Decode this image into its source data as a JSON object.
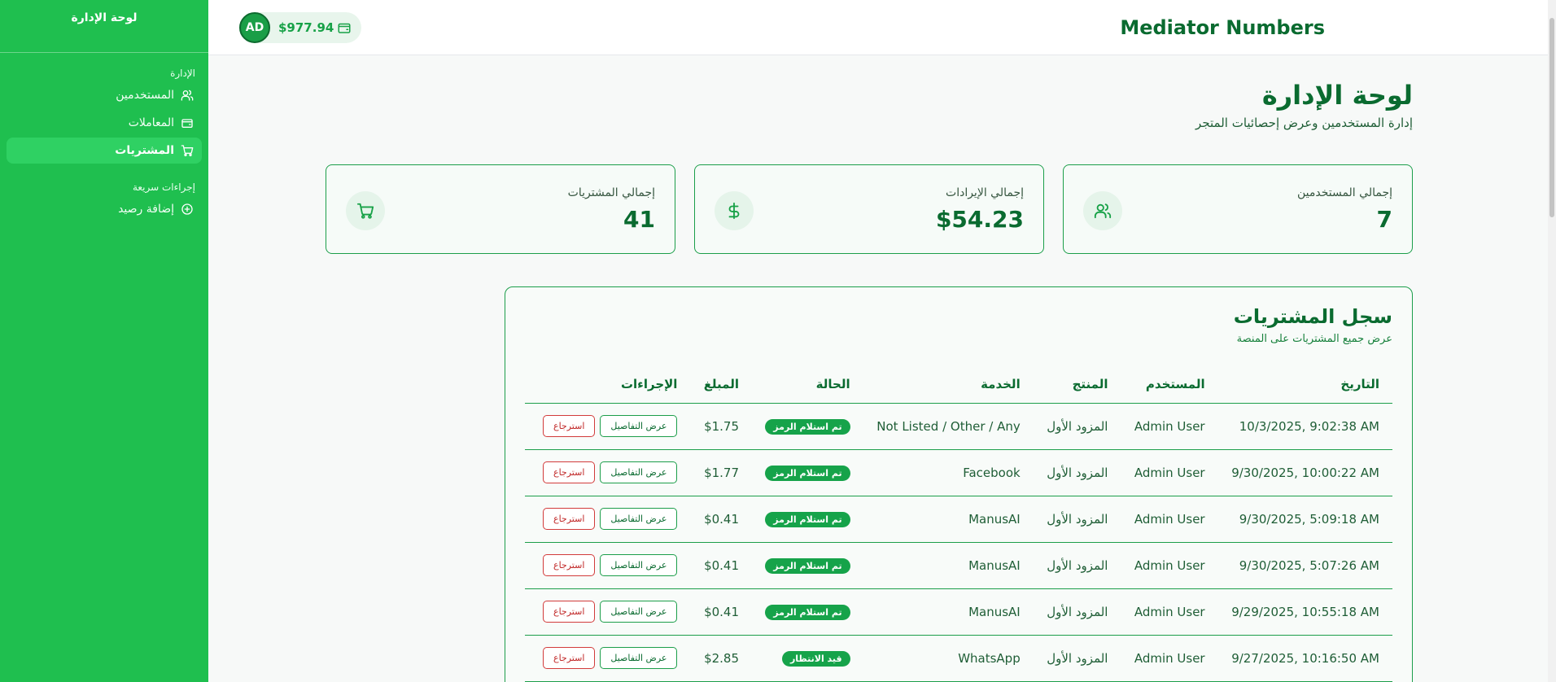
{
  "sidebar": {
    "title": "لوحة الإدارة",
    "sections": [
      {
        "label": "الإدارة",
        "items": [
          {
            "label": "المستخدمين",
            "icon": "users-icon"
          },
          {
            "label": "المعاملات",
            "icon": "wallet-icon"
          },
          {
            "label": "المشتريات",
            "icon": "cart-icon",
            "active": true
          }
        ]
      },
      {
        "label": "إجراءات سريعة",
        "items": [
          {
            "label": "إضافة رصيد",
            "icon": "plus-circle-icon"
          }
        ]
      }
    ]
  },
  "header": {
    "brand": "Mediator Numbers",
    "avatar_initials": "AD",
    "balance": "$977.94"
  },
  "page": {
    "title": "لوحة الإدارة",
    "subtitle": "إدارة المستخدمين وعرض إحصائيات المتجر"
  },
  "stats": [
    {
      "label": "إجمالي المستخدمين",
      "value": "7",
      "icon": "users-icon"
    },
    {
      "label": "إجمالي الإيرادات",
      "value": "$54.23",
      "icon": "dollar-icon"
    },
    {
      "label": "إجمالي المشتريات",
      "value": "41",
      "icon": "cart-icon"
    }
  ],
  "purchases": {
    "title": "سجل المشتريات",
    "subtitle": "عرض جميع المشتريات على المنصة",
    "columns": {
      "date": "التاريخ",
      "user": "المستخدم",
      "product": "المنتج",
      "service": "الخدمة",
      "status": "الحالة",
      "amount": "المبلغ",
      "actions": "الإجراءات"
    },
    "details_label": "عرض التفاصيل",
    "refund_label": "استرجاع",
    "rows": [
      {
        "date": "10/3/2025, 9:02:38 AM",
        "user": "Admin User",
        "product": "المزود الأول",
        "service": "Not Listed / Other / Any",
        "status": "تم استلام الرمز",
        "amount": "$1.75"
      },
      {
        "date": "9/30/2025, 10:00:22 AM",
        "user": "Admin User",
        "product": "المزود الأول",
        "service": "Facebook",
        "status": "تم استلام الرمز",
        "amount": "$1.77"
      },
      {
        "date": "9/30/2025, 5:09:18 AM",
        "user": "Admin User",
        "product": "المزود الأول",
        "service": "ManusAI",
        "status": "تم استلام الرمز",
        "amount": "$0.41"
      },
      {
        "date": "9/30/2025, 5:07:26 AM",
        "user": "Admin User",
        "product": "المزود الأول",
        "service": "ManusAI",
        "status": "تم استلام الرمز",
        "amount": "$0.41"
      },
      {
        "date": "9/29/2025, 10:55:18 AM",
        "user": "Admin User",
        "product": "المزود الأول",
        "service": "ManusAI",
        "status": "تم استلام الرمز",
        "amount": "$0.41"
      },
      {
        "date": "9/27/2025, 10:16:50 AM",
        "user": "Admin User",
        "product": "المزود الأول",
        "service": "WhatsApp",
        "status": "قيد الانتظار",
        "amount": "$2.85"
      }
    ]
  },
  "colors": {
    "sidebar": "#1fbf4f",
    "brand": "#0a6b30",
    "badge": "#16a34a",
    "danger": "#c02626"
  }
}
